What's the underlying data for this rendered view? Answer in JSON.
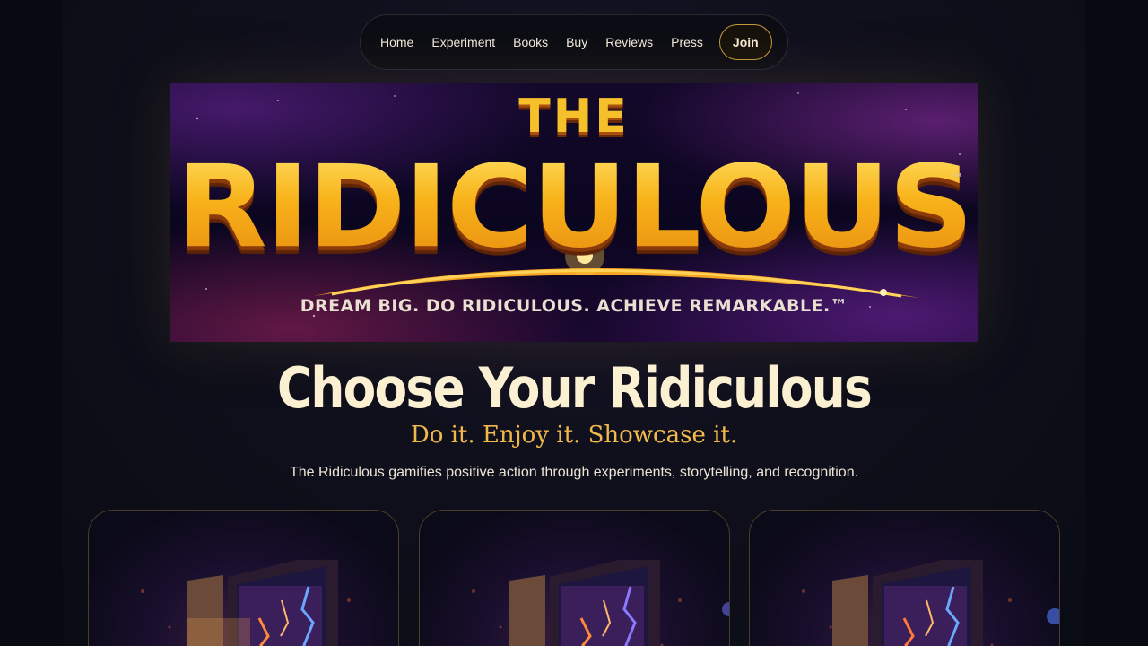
{
  "nav": {
    "items": [
      "Home",
      "Experiment",
      "Books",
      "Buy",
      "Reviews",
      "Press"
    ],
    "join_label": "Join"
  },
  "banner": {
    "the": "THE",
    "title": "RIDICULOUS",
    "tm": "™",
    "tagline": "DREAM BIG. DO RIDICULOUS. ACHIEVE REMARKABLE.™"
  },
  "hero": {
    "title": "Choose Your Ridiculous",
    "subtitle": "Do it. Enjoy it. Showcase it.",
    "lead": "The Ridiculous gamifies positive action through experiments, storytelling, and recognition."
  },
  "cards": [
    {
      "image": "open-door-lightning-icon"
    },
    {
      "image": "open-door-lightning-icon"
    },
    {
      "image": "open-door-lightning-icon"
    }
  ],
  "colors": {
    "accent_gold": "#f1b84a",
    "heading_cream": "#fbf0d2",
    "background": "#070a10"
  }
}
